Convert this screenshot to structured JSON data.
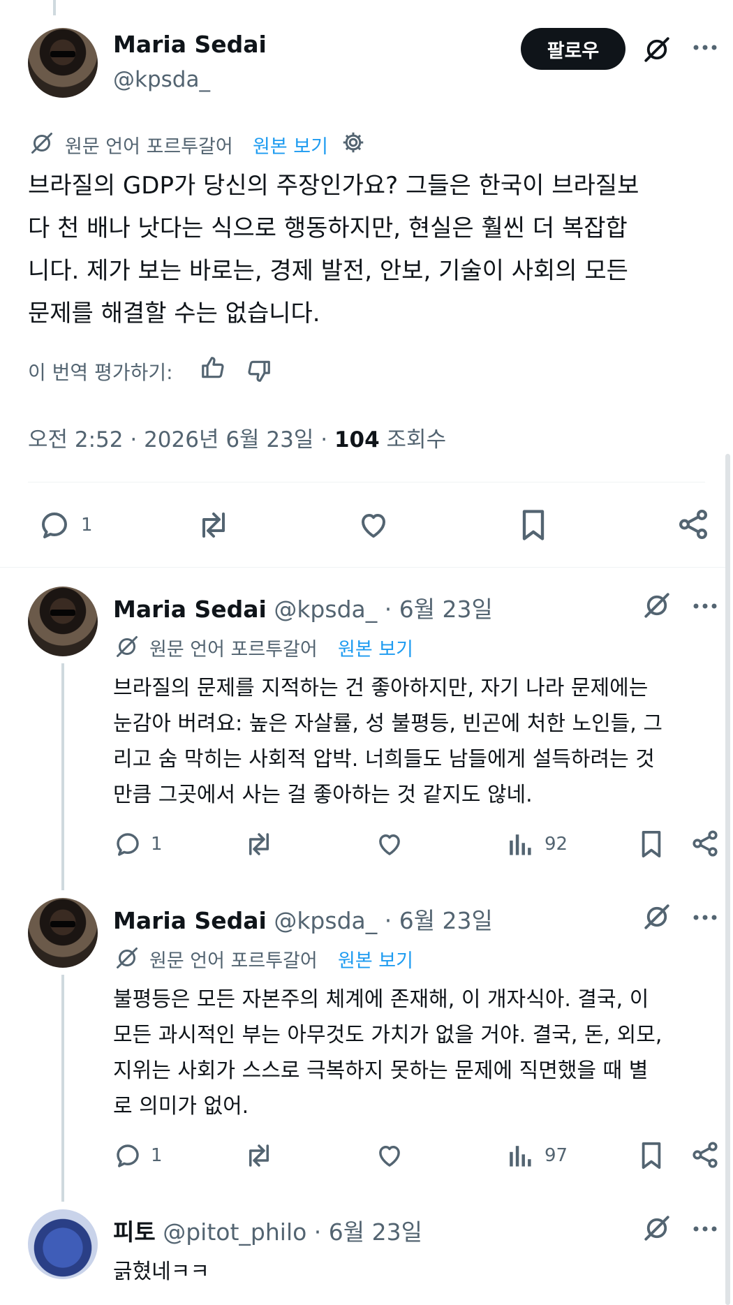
{
  "main_tweet": {
    "author_name": "Maria Sedai",
    "handle": "@kpsda_",
    "follow_label": "팔로우",
    "translation_note": "원문 언어 포르투갈어",
    "view_original": "원본 보기",
    "text_lines": [
      "브라질의 GDP가 당신의 주장인가요? 그들은 한국이 브라질보",
      "다 천 배나 낫다는 식으로 행동하지만, 현실은 훨씬 더 복잡합",
      "니다. 제가 보는 바로는, 경제 발전, 안보, 기술이 사회의 모든",
      "문제를 해결할 수는 없습니다."
    ],
    "rate_translation": "이 번역 평가하기:",
    "timestamp": "오전 2:52 · 2026년 6월 23일 · ",
    "views_count": "104",
    "views_label": " 조회수",
    "reply_count": "1"
  },
  "replies": [
    {
      "author_name": "Maria Sedai",
      "handle": "@kpsda_",
      "date": " · 6월 23일",
      "translation_note": "원문 언어 포르투갈어",
      "view_original": "원본 보기",
      "text_lines": [
        "브라질의 문제를 지적하는 건 좋아하지만, 자기 나라 문제에는",
        "눈감아 버려요: 높은 자살률, 성 불평등, 빈곤에 처한 노인들, 그",
        "리고 숨 막히는 사회적 압박. 너희들도 남들에게 설득하려는 것",
        "만큼 그곳에서 사는 걸 좋아하는 것 같지도 않네."
      ],
      "reply_count": "1",
      "views": "92"
    },
    {
      "author_name": "Maria Sedai",
      "handle": "@kpsda_",
      "date": " · 6월 23일",
      "translation_note": "원문 언어 포르투갈어",
      "view_original": "원본 보기",
      "text_lines": [
        "불평등은 모든 자본주의 체계에 존재해, 이 개자식아. 결국, 이",
        "모든 과시적인 부는 아무것도 가치가 없을 거야. 결국, 돈, 외모,",
        "지위는 사회가 스스로 극복하지 못하는 문제에 직면했을 때 별",
        "로 의미가 없어."
      ],
      "reply_count": "1",
      "views": "97"
    },
    {
      "author_name": "피토",
      "handle": "@pitot_philo",
      "date": " · 6월 23일",
      "text_lines": [
        "긁혔네ㅋㅋ"
      ]
    }
  ],
  "icons": {
    "translate": "translate-slash-icon",
    "gear": "gear-icon",
    "more": "more-icon",
    "reply": "reply-icon",
    "retweet": "retweet-icon",
    "like": "like-icon",
    "bookmark": "bookmark-icon",
    "share": "share-icon",
    "views": "views-icon",
    "thumbs_up": "thumbs-up-icon",
    "thumbs_down": "thumbs-down-icon"
  },
  "colors": {
    "text": "#0f1419",
    "muted": "#536471",
    "link": "#1d9bf0",
    "follow_bg": "#0f1419"
  }
}
